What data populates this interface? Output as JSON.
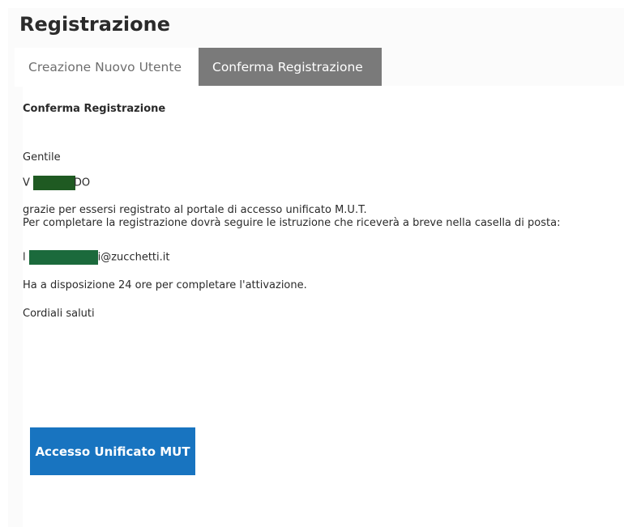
{
  "page": {
    "title": "Registrazione"
  },
  "tabs": [
    {
      "label": "Creazione Nuovo Utente",
      "active": false
    },
    {
      "label": "Conferma Registrazione",
      "active": true
    }
  ],
  "content": {
    "heading": "Conferma Registrazione",
    "greeting": "Gentile",
    "name_prefix": "V",
    "name_suffix": "DO",
    "line1": "grazie per essersi registrato al portale di accesso unificato M.U.T.",
    "line2": "Per completare la registrazione dovrà seguire le istruzione che riceverà a breve nella casella di posta:",
    "email_prefix": "l",
    "email_suffix": "i@zucchetti.it",
    "availability": "Ha a disposizione 24 ore per completare l'attivazione.",
    "closing": "Cordiali saluti"
  },
  "actions": {
    "mut_button_label": "Accesso Unificato MUT"
  },
  "colors": {
    "active_tab": "#7a7a7a",
    "primary_button": "#1874c0",
    "redaction": "#1f5a22"
  }
}
